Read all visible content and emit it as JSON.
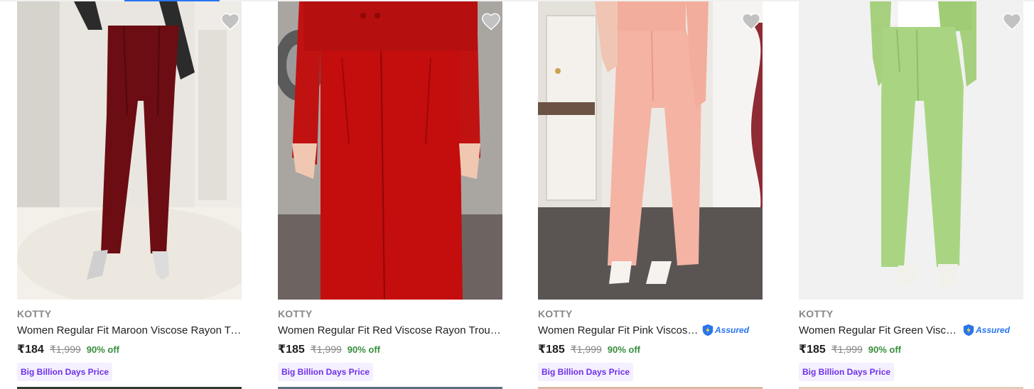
{
  "colors": {
    "brand_text": "#878787",
    "title_text": "#212121",
    "discount_green": "#388e3c",
    "badge_bg": "#f4f0ff",
    "badge_text": "#6f30e9",
    "assured_blue": "#2874f0",
    "wishlist_icon": "#c2c2c2"
  },
  "products": [
    {
      "brand": "KOTTY",
      "title": "Women Regular Fit Maroon Viscose Rayon Trousers",
      "price": "₹184",
      "mrp": "₹1,999",
      "discount": "90% off",
      "assured_label": "",
      "badge": "Big Billion Days Price",
      "icon": "heart-icon"
    },
    {
      "brand": "KOTTY",
      "title": "Women Regular Fit Red Viscose Rayon Trousers",
      "price": "₹185",
      "mrp": "₹1,999",
      "discount": "90% off",
      "assured_label": "",
      "badge": "Big Billion Days Price",
      "icon": "heart-icon"
    },
    {
      "brand": "KOTTY",
      "title": "Women Regular Fit Pink Viscose Rayon Trousers",
      "price": "₹185",
      "mrp": "₹1,999",
      "discount": "90% off",
      "assured_label": "Assured",
      "badge": "Big Billion Days Price",
      "icon": "heart-icon"
    },
    {
      "brand": "KOTTY",
      "title": "Women Regular Fit Green Viscose Rayon Trousers",
      "price": "₹185",
      "mrp": "₹1,999",
      "discount": "90% off",
      "assured_label": "Assured",
      "badge": "Big Billion Days Price",
      "icon": "heart-icon"
    }
  ]
}
